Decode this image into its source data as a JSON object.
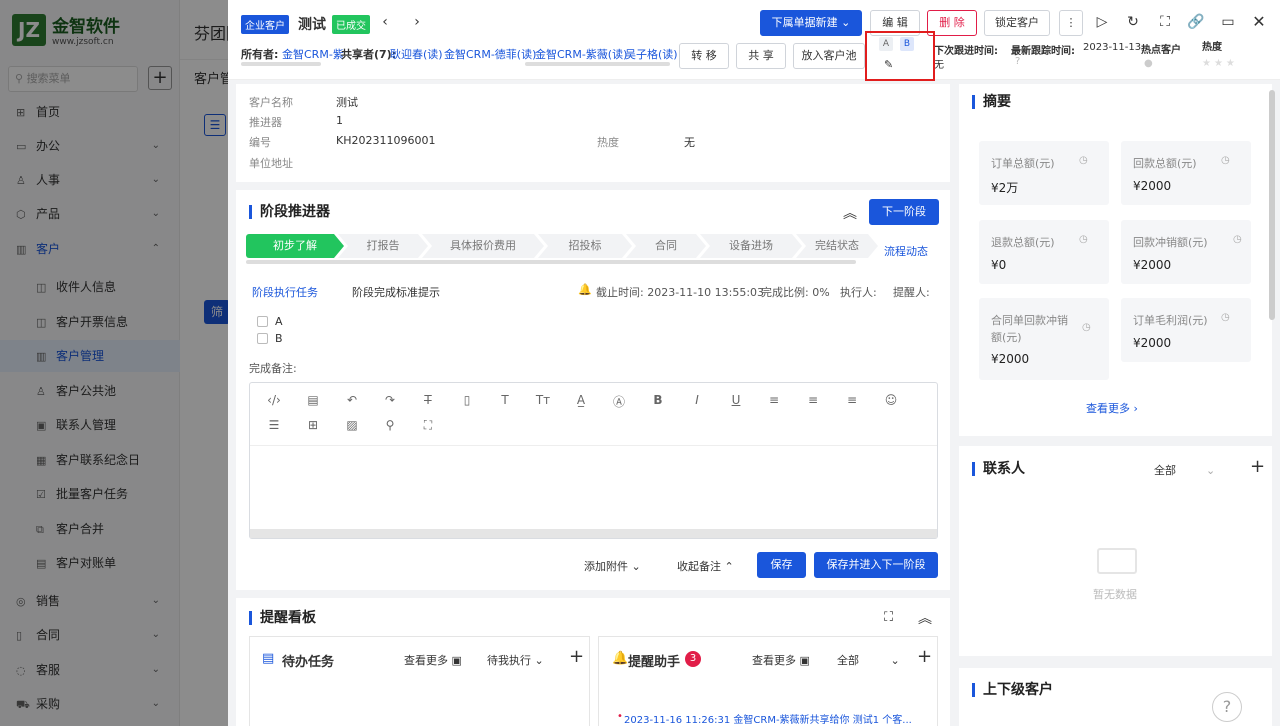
{
  "app": {
    "logo_mark": "JZ",
    "logo_name": "金智软件",
    "logo_url": "www.jzsoft.cn",
    "top_title": "芬团隊",
    "search_placeholder": "搜索菜单",
    "breadcrumb_bg": "客户管"
  },
  "sidebar": {
    "items": [
      {
        "label": "首页",
        "icon": "home-icon"
      },
      {
        "label": "办公",
        "icon": "office-icon",
        "chev": "⌄"
      },
      {
        "label": "人事",
        "icon": "people-icon",
        "chev": "⌄"
      },
      {
        "label": "产品",
        "icon": "product-icon",
        "chev": "⌄"
      },
      {
        "label": "客户",
        "icon": "customer-icon",
        "chev": "⌃"
      },
      {
        "label": "收件人信息"
      },
      {
        "label": "客户开票信息"
      },
      {
        "label": "客户管理"
      },
      {
        "label": "客户公共池"
      },
      {
        "label": "联系人管理"
      },
      {
        "label": "客户联系纪念日"
      },
      {
        "label": "批量客户任务"
      },
      {
        "label": "客户合并"
      },
      {
        "label": "客户对账单"
      },
      {
        "label": "销售",
        "chev": "⌄"
      },
      {
        "label": "合同",
        "chev": "⌄"
      },
      {
        "label": "客服",
        "chev": "⌄"
      },
      {
        "label": "采购",
        "chev": "⌄"
      }
    ]
  },
  "header": {
    "tag_enterprise": "企业客户",
    "customer_name": "测试",
    "tag_deal": "已成交",
    "new_sub_doc": "下属单据新建",
    "edit": "编 辑",
    "delete": "删 除",
    "lock": "锁定客户",
    "owner_label": "所有者:",
    "owner_value": "金智CRM-紫",
    "sharers_label": "共享者(7):",
    "sharers": [
      "耿迎春(读)",
      "金智CRM-德菲(读)",
      "金智CRM-紫薇(读)",
      "吴子格(读)"
    ],
    "transfer": "转 移",
    "share": "共 享",
    "to_pool": "放入客户池",
    "tag_a": "A",
    "tag_b": "B",
    "next_follow_label": "下次跟进时间:",
    "next_follow_value": "无",
    "last_follow_label": "最新跟踪时间:",
    "last_follow_value": "2023-11-13",
    "hot_customer": "热点客户",
    "heat_label": "热度",
    "heat_stars": 0
  },
  "info": {
    "name_label": "客户名称",
    "name_value": "测试",
    "pusher_label": "推进器",
    "pusher_value": "1",
    "code_label": "编号",
    "code_value": "KH202311096001",
    "heat_label": "热度",
    "heat_value": "无",
    "address_label": "单位地址",
    "address_value": ""
  },
  "stages": {
    "title": "阶段推进器",
    "next_button": "下一阶段",
    "flow_link": "流程动态",
    "items": [
      "初步了解",
      "打报告",
      "具体报价费用",
      "招投标",
      "合同",
      "设备进场",
      "完结状态"
    ],
    "task_tab": "阶段执行任务",
    "hint_tab": "阶段完成标准提示",
    "deadline": "截止时间: 2023-11-10 13:55:03",
    "ratio": "完成比例: 0%",
    "executor": "执行人:",
    "reminder": "提醒人:",
    "checklist": [
      "A",
      "B"
    ],
    "remark_label": "完成备注:",
    "attach": "添加附件",
    "collapse_remark": "收起备注",
    "save": "保存",
    "save_next": "保存并进入下一阶段"
  },
  "board": {
    "title": "提醒看板",
    "todo_title": "待办任务",
    "todo_more": "查看更多",
    "todo_filter": "待我执行",
    "assistant_title": "提醒助手",
    "assistant_badge": "3",
    "assistant_more": "查看更多",
    "assistant_filter": "全部",
    "assistant_item": "2023-11-16 11:26:31 金智CRM-紫薇新共享给你 测试1 个客..."
  },
  "summary": {
    "title": "摘要",
    "cards": [
      {
        "label": "订单总额(元)",
        "value": "¥2万"
      },
      {
        "label": "回款总额(元)",
        "value": "¥2000"
      },
      {
        "label": "退款总额(元)",
        "value": "¥0"
      },
      {
        "label": "回款冲销额(元)",
        "value": "¥2000"
      },
      {
        "label": "合同单回款冲销额(元)",
        "value": "¥2000"
      },
      {
        "label": "订单毛利润(元)",
        "value": "¥2000"
      }
    ],
    "more": "查看更多"
  },
  "contacts": {
    "title": "联系人",
    "filter": "全部",
    "empty": "暂无数据"
  },
  "parent": {
    "title": "上下级客户"
  },
  "colors": {
    "accent": "#1a56db",
    "success": "#22c55e",
    "danger": "#e11d48"
  }
}
